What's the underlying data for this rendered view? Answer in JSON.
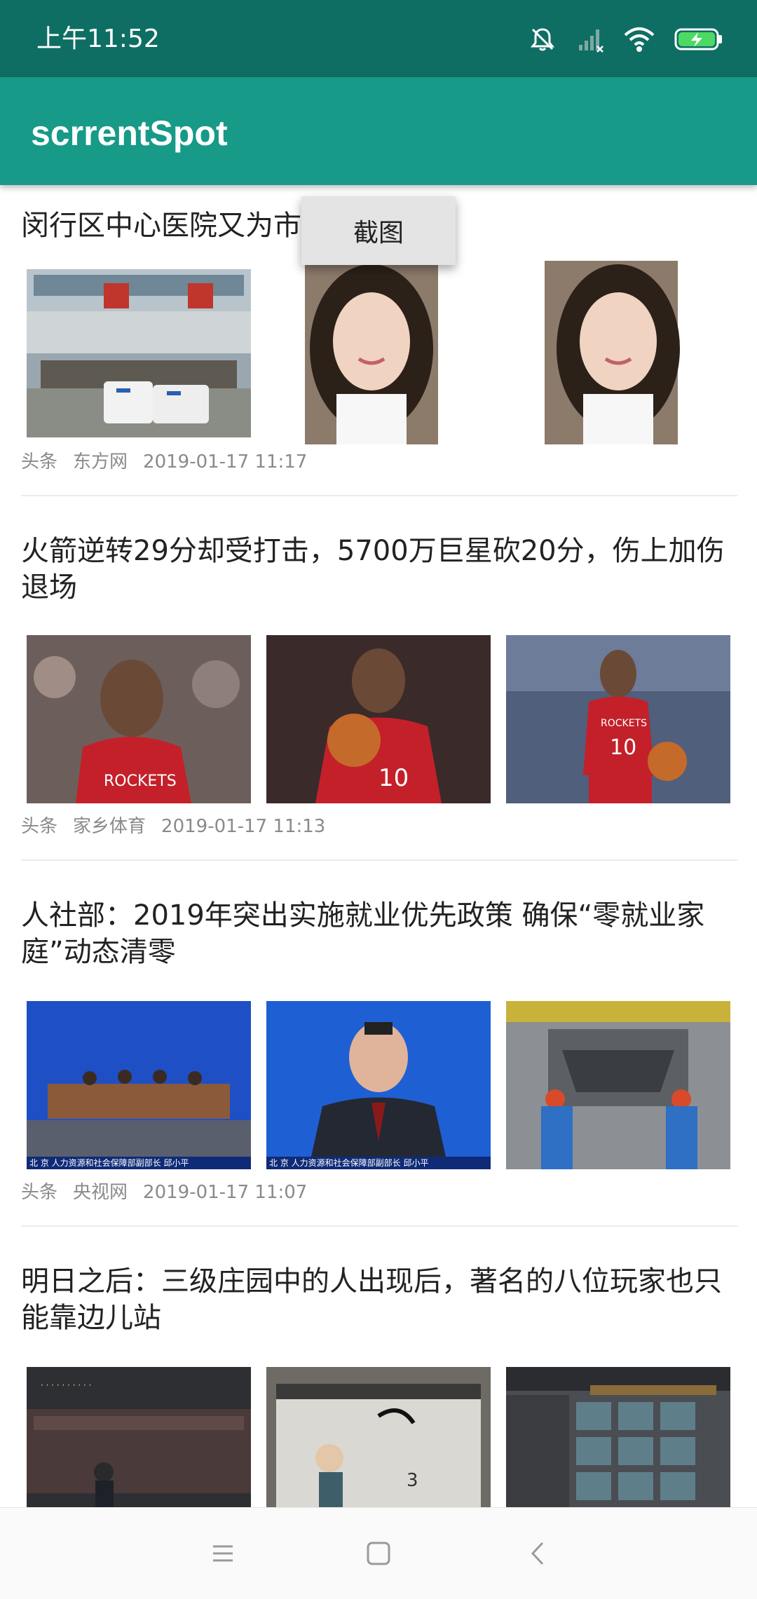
{
  "status_bar": {
    "time": "上午11:52",
    "icons": [
      "mute-bell-icon",
      "signal-off-icon",
      "wifi-icon",
      "battery-charging-icon"
    ],
    "battery_color": "#4cd964"
  },
  "app_bar": {
    "title": "scrrentSpot"
  },
  "popup_menu": {
    "items": [
      {
        "label": "截图"
      }
    ]
  },
  "feed": [
    {
      "title": "闵行区中心医院又为市民送福利",
      "source_tag": "头条",
      "source": "东方网",
      "time": "2019-01-17 11:17",
      "thumbs": [
        "hospital-photo",
        "portrait-photo",
        "portrait-photo"
      ]
    },
    {
      "title": "火箭逆转29分却受打击，5700万巨星砍20分，伤上加伤退场",
      "source_tag": "头条",
      "source": "家乡体育",
      "time": "2019-01-17 11:13",
      "thumbs": [
        "basketball-photo",
        "basketball-photo",
        "basketball-photo"
      ]
    },
    {
      "title": "人社部：2019年突出实施就业优先政策 确保“零就业家庭”动态清零",
      "source_tag": "头条",
      "source": "央视网",
      "time": "2019-01-17 11:07",
      "thumbs": [
        "press-conference-photo",
        "press-conference-photo",
        "workers-photo"
      ],
      "thumb_captions": [
        "北 京 人力资源和社会保障部副部长 邱小平",
        "北 京 人力资源和社会保障部副部长 邱小平"
      ]
    },
    {
      "title": "明日之后：三级庄园中的人出现后，著名的八位玩家也只能靠边儿站",
      "thumbs": [
        "game-screenshot",
        "game-screenshot",
        "game-screenshot"
      ]
    }
  ],
  "nav_bar": {
    "buttons": [
      "menu-icon",
      "home-icon",
      "back-icon"
    ]
  },
  "colors": {
    "status_bar": "#0f6e63",
    "app_bar": "#179a87"
  }
}
